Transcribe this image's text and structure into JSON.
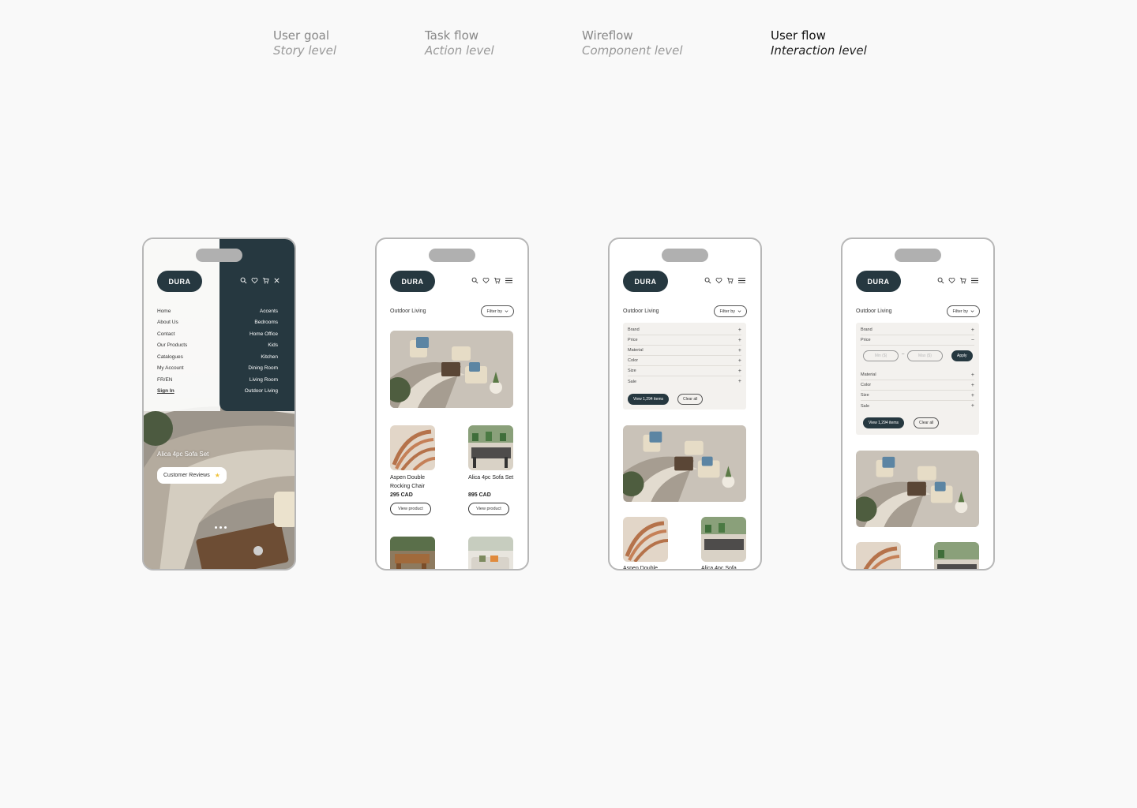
{
  "tabs": [
    {
      "title": "User goal",
      "subtitle": "Story level"
    },
    {
      "title": "Task flow",
      "subtitle": "Action level"
    },
    {
      "title": "Wireflow",
      "subtitle": "Component level"
    },
    {
      "title": "User flow",
      "subtitle": "Interaction level"
    }
  ],
  "brand": {
    "logo": "DURA"
  },
  "phone1": {
    "menu_left": [
      "Home",
      "About Us",
      "Contact",
      "Our Products",
      "Catalogues",
      "My Account",
      "FR/EN",
      "Sign In"
    ],
    "menu_right": [
      "Accents",
      "Bedrooms",
      "Home Office",
      "Kids",
      "Kitchen",
      "Dining Room",
      "Living Room",
      "Outdoor Living"
    ],
    "product_title": "Alica 4pc Sofa Set",
    "reviews_label": "Customer Reviews"
  },
  "listing": {
    "section": "Outdoor Living",
    "filter_label": "Filter by",
    "products": [
      {
        "name": "Aspen Double Rocking Chair",
        "price": "295 CAD",
        "cta": "View product"
      },
      {
        "name": "Alica 4pc Sofa Set",
        "price": "895 CAD",
        "cta": "View product"
      }
    ]
  },
  "filters": {
    "rows": [
      "Brand",
      "Price",
      "Material",
      "Color",
      "Size",
      "Sale"
    ],
    "view_items": "View 1,294 items",
    "clear_all": "Clear all",
    "min_placeholder": "Min ($)",
    "max_placeholder": "Max ($)",
    "dash": "–",
    "apply": "Apply"
  },
  "phone3_partial": {
    "p1": "Aspen Double",
    "p2": "Alica 4pc Sofa"
  },
  "colors": {
    "brand_dark": "#263840",
    "star": "#f0c33c",
    "panel": "#f3f1ee"
  }
}
